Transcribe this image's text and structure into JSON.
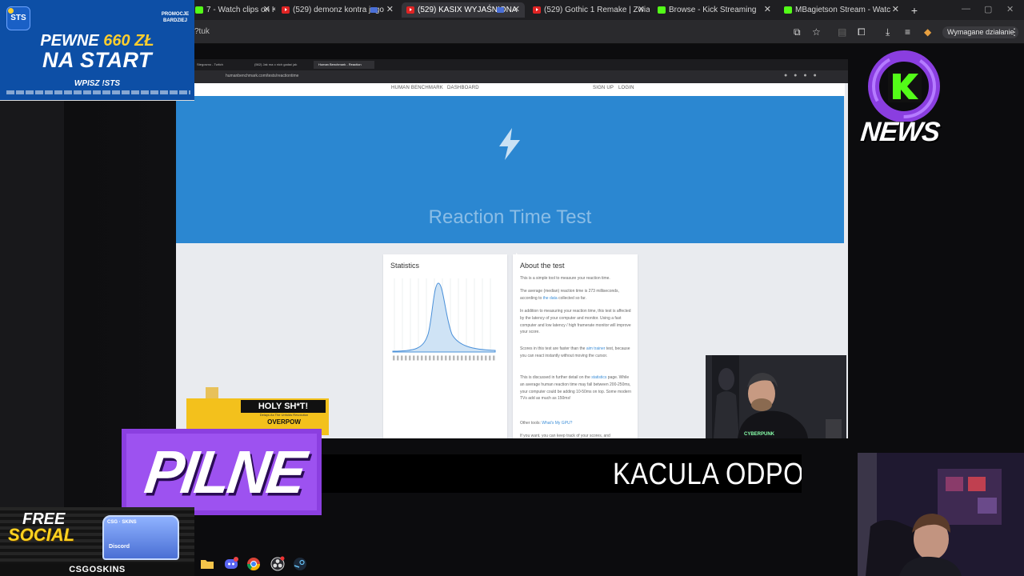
{
  "browser": {
    "tabs": [
      {
        "label": "7 - Watch clips on Ki",
        "favicon": "kick",
        "active": false
      },
      {
        "label": "(529) demonz kontra jego",
        "favicon": "youtube",
        "active": false
      },
      {
        "label": "(529) KASIX WYJAŚNIONA",
        "favicon": "youtube",
        "active": true
      },
      {
        "label": "(529) Gothic 1 Remake | Zwiasu",
        "favicon": "youtube",
        "active": false
      },
      {
        "label": "Browse - Kick Streaming",
        "favicon": "kick",
        "active": false
      },
      {
        "label": "MBagietson Stream - Watc",
        "favicon": "kick",
        "active": false
      }
    ],
    "url_fragment": "?tuk",
    "action_required_label": "Wymagane działanie"
  },
  "inner_screen": {
    "tabs": [
      "Stegosmo - Twitch",
      "(562) Jak ma o nich gadać jak",
      "Human Benchmark - Reaction"
    ],
    "url": "humanbenchmark.com/tests/reactiontime",
    "nav": {
      "brand": "HUMAN BENCHMARK",
      "dashboard": "DASHBOARD",
      "signup": "SIGN UP",
      "login": "LOGIN"
    },
    "hero_title": "Reaction Time Test",
    "stats_title": "Statistics",
    "about": {
      "title": "About the test",
      "paragraphs": [
        {
          "before": "This is a simple tool to measure your reaction time.",
          "link": "",
          "after": ""
        },
        {
          "before": "The average (median) reaction time is 273 milliseconds, according to ",
          "link": "the data",
          "after": " collected so far."
        },
        {
          "before": "In addition to measuring your reaction time, this test is affected by the latency of your computer and monitor. Using a fast computer and low latency / high framerate monitor will improve your score.",
          "link": "",
          "after": ""
        },
        {
          "before": "Scores in this test are faster than the ",
          "link": "aim trainer",
          "after": " test, because you can react instantly without moving the cursor."
        },
        {
          "before": "This is discussed in further detail on the ",
          "link": "statistics",
          "after": " page. While an average human reaction time may fall between 200-250ms, your computer could be adding 10-50ms on top. Some modern TVs add as much as 150ms!"
        },
        {
          "before": "Other tools: ",
          "link": "What's My GPU?",
          "after": ""
        },
        {
          "before": "If you want, you can keep track of your scores, and",
          "link": "",
          "after": ""
        }
      ]
    }
  },
  "overlays": {
    "promo": {
      "logo": "STS",
      "corner_tag": "PROMOCJE BARDZIEJ",
      "line1_a": "PEWNE ",
      "line1_b": "660 ZŁ",
      "line2": "NA START",
      "line3": "WPISZ !STS"
    },
    "knews_label": "NEWS",
    "holy": {
      "title": "HOLY SH*T!",
      "subtitle": "Delays As The Unfolds Revolution",
      "badge": "OVERPOW"
    },
    "breaking_label": "PILNE",
    "ticker_text": "KACULA ODPOW",
    "free_social": {
      "line1": "FREE",
      "line2": "SOCIAL",
      "case_label": "CSG · SKINS",
      "discord": "Discord",
      "brand": "CSGOSKINS"
    }
  },
  "taskbar_icons": [
    "folder-icon",
    "discord-icon",
    "chrome-icon",
    "obs-icon",
    "steam-icon"
  ],
  "colors": {
    "hero_blue": "#2b87d1",
    "breaking_purple": "#9d52f0",
    "promo_blue": "#0d4fa6",
    "kick_green": "#53fc18"
  }
}
